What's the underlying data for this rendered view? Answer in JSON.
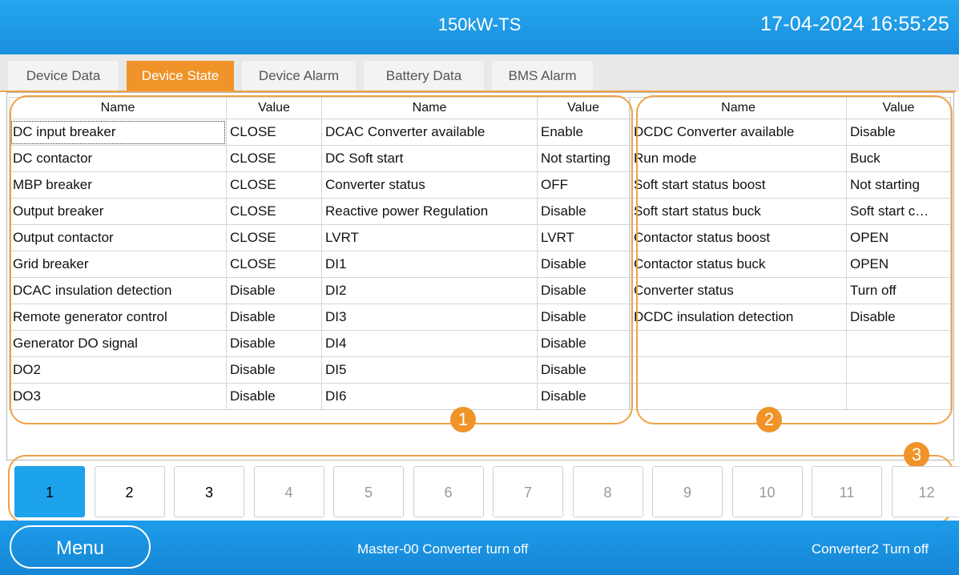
{
  "header": {
    "title": "150kW-TS",
    "datetime": "17-04-2024 16:55:25"
  },
  "tabs": [
    "Device Data",
    "Device State",
    "Device Alarm",
    "Battery Data",
    "BMS Alarm"
  ],
  "active_tab": 1,
  "headers": {
    "name": "Name",
    "value": "Value"
  },
  "table1": [
    [
      "DC input breaker",
      "CLOSE"
    ],
    [
      "DC contactor",
      "CLOSE"
    ],
    [
      "MBP breaker",
      "CLOSE"
    ],
    [
      "Output breaker",
      "CLOSE"
    ],
    [
      "Output contactor",
      "CLOSE"
    ],
    [
      "Grid breaker",
      "CLOSE"
    ],
    [
      "DCAC insulation detection",
      "Disable"
    ],
    [
      "Remote generator control",
      "Disable"
    ],
    [
      "Generator DO signal",
      "Disable"
    ],
    [
      "DO2",
      "Disable"
    ],
    [
      "DO3",
      "Disable"
    ]
  ],
  "table2": [
    [
      "DCAC Converter available",
      "Enable"
    ],
    [
      "DC Soft start",
      "Not starting"
    ],
    [
      "Converter status",
      "OFF"
    ],
    [
      "Reactive power Regulation",
      "Disable"
    ],
    [
      "LVRT",
      "LVRT"
    ],
    [
      "DI1",
      "Disable"
    ],
    [
      "DI2",
      "Disable"
    ],
    [
      "DI3",
      "Disable"
    ],
    [
      "DI4",
      "Disable"
    ],
    [
      "DI5",
      "Disable"
    ],
    [
      "DI6",
      "Disable"
    ]
  ],
  "table3": [
    [
      "DCDC Converter available",
      "Disable"
    ],
    [
      "Run mode",
      "Buck"
    ],
    [
      "Soft start status boost",
      "Not starting"
    ],
    [
      "Soft start status buck",
      "Soft start c…"
    ],
    [
      "Contactor status boost",
      "OPEN"
    ],
    [
      "Contactor status buck",
      "OPEN"
    ],
    [
      "Converter status",
      "Turn off"
    ],
    [
      "DCDC insulation detection",
      "Disable"
    ],
    [
      "",
      ""
    ],
    [
      "",
      ""
    ],
    [
      "",
      ""
    ]
  ],
  "badges": [
    "1",
    "2",
    "3"
  ],
  "pages": [
    "1",
    "2",
    "3",
    "4",
    "5",
    "6",
    "7",
    "8",
    "9",
    "10",
    "11",
    "12"
  ],
  "active_page": 1,
  "enabled_pages": 3,
  "footer": {
    "menu_label": "Menu",
    "status": "Master-00 Converter turn off",
    "status_right": "Converter2 Turn off"
  },
  "colors": {
    "header_blue": "#1a9be6",
    "accent_orange": "#f09328",
    "active_page_blue": "#1ca3ec"
  }
}
